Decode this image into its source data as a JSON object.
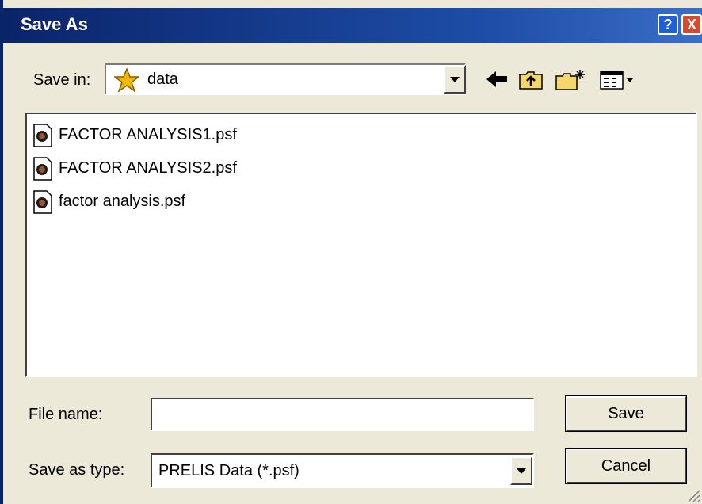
{
  "dialog": {
    "title": "Save As",
    "help_glyph": "?",
    "close_glyph": "X"
  },
  "save_in": {
    "label": "Save in:",
    "value": "data",
    "icon": "star-folder-icon"
  },
  "toolbar": {
    "back_icon": "back-arrow-icon",
    "up_icon": "up-folder-icon",
    "new_folder_icon": "new-folder-icon",
    "view_menu_icon": "view-menu-icon"
  },
  "files": [
    {
      "name": "FACTOR ANALYSIS1.psf",
      "icon": "psf-file-icon"
    },
    {
      "name": "FACTOR ANALYSIS2.psf",
      "icon": "psf-file-icon"
    },
    {
      "name": "factor analysis.psf",
      "icon": "psf-file-icon"
    }
  ],
  "file_name": {
    "label": "File name:",
    "value": ""
  },
  "save_as_type": {
    "label": "Save as type:",
    "value": "PRELIS Data (*.psf)"
  },
  "buttons": {
    "save": "Save",
    "cancel": "Cancel"
  },
  "colors": {
    "title_bar": "#0a246a",
    "window_bg": "#ece9d8",
    "close_button": "#d84a2e",
    "help_button": "#1c5fd8"
  }
}
